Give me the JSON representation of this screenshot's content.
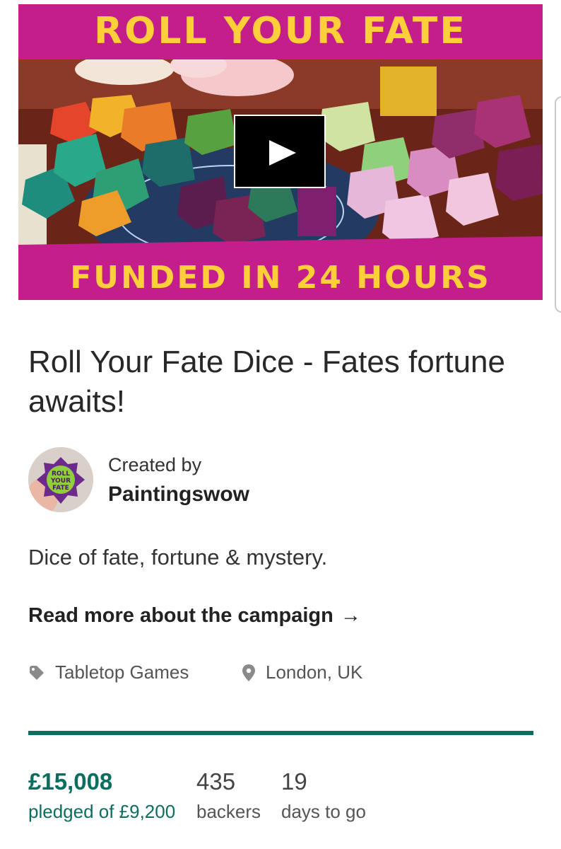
{
  "hero": {
    "banner_top": "ROLL YOUR FATE",
    "banner_bottom": "FUNDED IN 24 HOURS",
    "colors": {
      "band": "#c41e8c",
      "lettering": "#ffcf3a"
    }
  },
  "campaign": {
    "title": "Roll Your Fate Dice - Fates fortune awaits!",
    "created_by_label": "Created by",
    "creator_name": "Paintingswow",
    "avatar_text": "ROLL YOUR FATE",
    "blurb": "Dice of fate, fortune & mystery.",
    "read_more": "Read more about the campaign",
    "read_more_arrow": "→",
    "category": "Tabletop Games",
    "location": "London, UK"
  },
  "stats": {
    "funded_fraction": 1.0,
    "pledged_amount": "£15,008",
    "pledged_label": "pledged of £9,200",
    "backers_count": "435",
    "backers_label": "backers",
    "days_count": "19",
    "days_label": "days to go",
    "accent_color": "#0b6e5e"
  }
}
